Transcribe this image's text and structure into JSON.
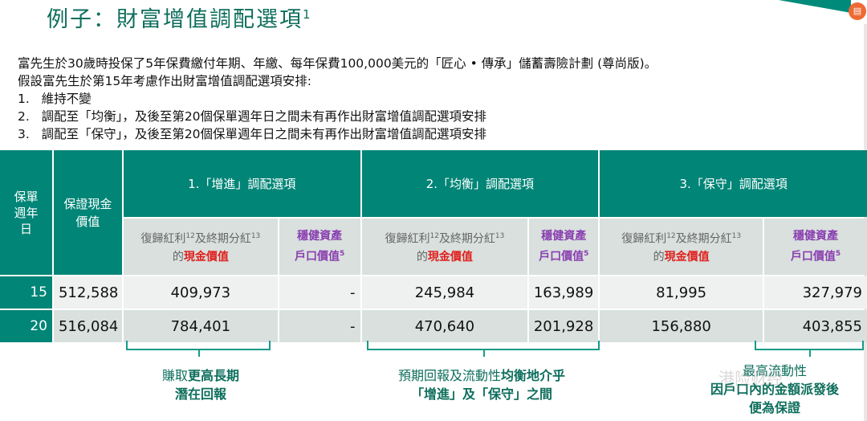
{
  "title": "例子：財富增值調配選項",
  "title_sup": "1",
  "intro": [
    "富先生於30歲時投保了5年保費繳付年期、年繳、每年保費100,000美元的「匠心 • 傳承」儲蓄壽險計劃 (尊尚版)。",
    "假設富先生於第15年考慮作出財富增值調配選項安排:",
    "1.   維持不變",
    "2.   調配至「均衡」，及後至第20個保單週年日之間未有再作出財富增值調配選項安排",
    "3.   調配至「保守」，及後至第20個保單週年日之間未有再作出財富增值調配選項安排"
  ],
  "table": {
    "col_year": "保單週年日",
    "col_guaranteed": "保證現金價值",
    "groups": [
      "1.「增進」調配選項",
      "2.「均衡」調配選項",
      "3.「保守」調配選項"
    ],
    "sub_a_pre": "復歸紅利",
    "sub_a_sup1": "12",
    "sub_a_mid": "及終期分紅",
    "sub_a_sup2": "13",
    "sub_a_of": "的",
    "sub_a_red": "現金價值",
    "sub_b": "穩健資產",
    "sub_b2": "戶口價值",
    "sub_b_sup": "5",
    "rows": [
      {
        "year": "15",
        "guaranteed": "512,588",
        "v": [
          "409,973",
          "-",
          "245,984",
          "163,989",
          "81,995",
          "327,979"
        ]
      },
      {
        "year": "20",
        "guaranteed": "516,084",
        "v": [
          "784,401",
          "-",
          "470,640",
          "201,928",
          "156,880",
          "403,855"
        ]
      }
    ]
  },
  "notes": [
    {
      "l1a": "賺取",
      "l1b": "更高長期",
      "l2": "潛在回報"
    },
    {
      "l1a": "預期回報及流動性",
      "l1b": "均衡地介乎",
      "l2": "「增進」及「保守」之間"
    },
    {
      "l1": "最高流動性",
      "l2": "因戶口內的金額派發後",
      "l3": "便為保證"
    }
  ],
  "watermark": "港险财经",
  "badge_icon": "document-icon",
  "colors": {
    "teal": "#008577",
    "red": "#e0201c",
    "purple": "#8a3fb0"
  }
}
